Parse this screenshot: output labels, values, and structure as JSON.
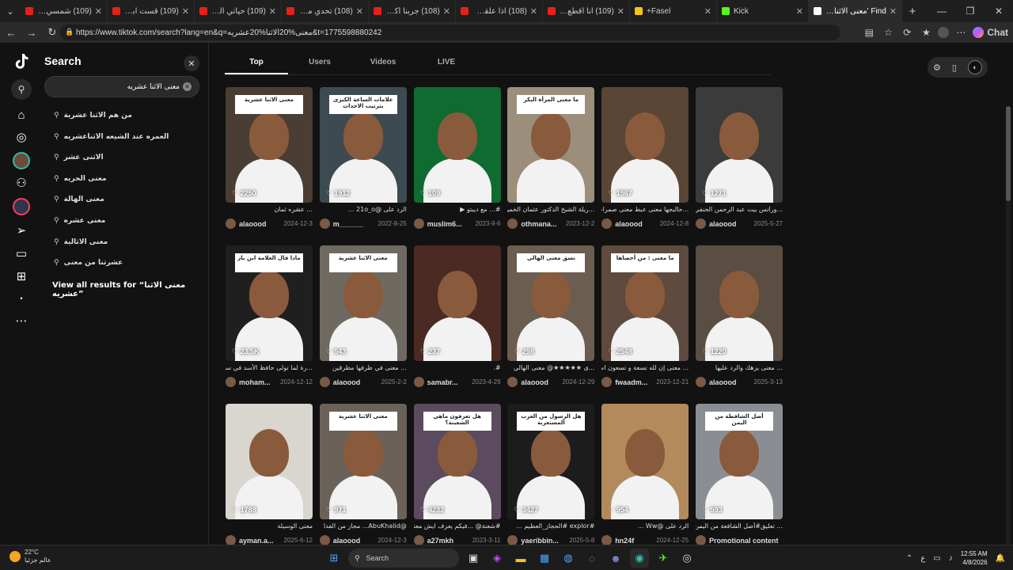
{
  "browser": {
    "tabs": [
      {
        "title": "(109) شمسي يفضح ما",
        "fav": "#e62117"
      },
      {
        "title": "(109) قست ابو عابد",
        "fav": "#e62117"
      },
      {
        "title": "(109) حياتي الجديدة",
        "fav": "#e62117"
      },
      {
        "title": "(108) تحدي مزاد الوف",
        "fav": "#e62117"
      },
      {
        "title": "(108) جربنا أكل شوار",
        "fav": "#e62117"
      },
      {
        "title": "(108) اذا علقت تتعاف",
        "fav": "#e62117"
      },
      {
        "title": "(109) أنا أقطع بدور",
        "fav": "#e62117"
      },
      {
        "title": "Fasel+",
        "fav": "#f5c518"
      },
      {
        "title": "Kick",
        "fav": "#53fc18"
      },
      {
        "title": "Find 'معنى الاثنا عشريه'",
        "fav": "#ffffff"
      }
    ],
    "url": "https://www.tiktok.com/search?lang=en&q=معنى%20الاثنا%20عشريه&t=1775598880242",
    "chat_label": "Chat"
  },
  "search": {
    "title": "Search",
    "query": "معنى الاثنا عشريه",
    "suggestions": [
      "من هم الاثنا عشرية",
      "العمره عند الشيعه الاثناعشريه",
      "الاثنى عشر",
      "معنى الحريه",
      "معنى الهالة",
      "معنى عشره",
      "معنى الاثالية",
      "عشرتنا من معنى"
    ],
    "view_all": "View all results for “معنى الاثنا عشريه”"
  },
  "results_tabs": [
    "Top",
    "Users",
    "Videos",
    "LIVE"
  ],
  "videos": [
    {
      "likes": "2250",
      "title": "... عشره ثمان",
      "user": "alaoood",
      "date": "2024-12-3",
      "bg": "#4a3d33",
      "caption": "معنى الاثنا عشرية"
    },
    {
      "likes": "1912",
      "title": "الرد على @21o_o ...",
      "user": "m______",
      "date": "2022-8-25",
      "bg": "#3d4a52",
      "caption": "علامات الساعة الكبرى بترتيب الاحداث"
    },
    {
      "likes": "109",
      "title": "#... مع ديبتو ▶",
      "user": "muslim6...",
      "date": "2023-9-6",
      "bg": "#0f6b2f",
      "caption": ""
    },
    {
      "likes": "",
      "title": "...ريلة الشيخ الدكتور عثمان الخميس",
      "user": "othmana...",
      "date": "2023-12-2",
      "bg": "#9b8f7c",
      "caption": "ما معنى المرأة البكر"
    },
    {
      "likes": "1567",
      "title": "...حالبجها معنى عبط معنى صمرات",
      "user": "alaoood",
      "date": "2024-12-8",
      "bg": "#5a4634",
      "caption": ""
    },
    {
      "likes": "1271",
      "title": "...ورانس بيت عبد الرحمن الحنفي",
      "user": "alaoood",
      "date": "2025-5-27",
      "bg": "#3b3b3b",
      "caption": ""
    },
    {
      "likes": "23.5K",
      "title": "...رة لما تولى حافظ الأسد في سوريا",
      "user": "moham...",
      "date": "2024-12-12",
      "bg": "#1f1f1f",
      "caption": "ماذا قال العلامة ابن باز"
    },
    {
      "likes": "543",
      "title": "... معنى في طرفها مطرقين",
      "user": "alaoood",
      "date": "2025-2-2",
      "bg": "#6e6a62",
      "caption": "معنى الاثنا عشرية"
    },
    {
      "likes": "237",
      "title": "#.",
      "user": "samabr...",
      "date": "2023-4-29",
      "bg": "#4a2a22",
      "caption": ""
    },
    {
      "likes": "298",
      "title": "...ى ★★★★★@ معنى الهالي",
      "user": "alaoood",
      "date": "2024-12-29",
      "bg": "#6b5d50",
      "caption": "نسق معنى الهالي"
    },
    {
      "likes": "2548",
      "title": "... معنى إن لله تسعة و تسعون اسما",
      "user": "fwaadm...",
      "date": "2023-12-21",
      "bg": "#5e4a3e",
      "caption": "ما معنى : من أحصاها"
    },
    {
      "likes": "1220",
      "title": "... معنى يزهك والرد عليها",
      "user": "alaoood",
      "date": "2025-3-13",
      "bg": "#5a4d42",
      "caption": ""
    },
    {
      "likes": "1788",
      "title": "معنى الوسيلة",
      "user": "ayman.a...",
      "date": "2025-6-12",
      "bg": "#d9d6cf",
      "caption": ""
    },
    {
      "likes": "971",
      "title": "@AbuKhalid... مجاز من الفدا",
      "user": "alaoood",
      "date": "2024-12-3",
      "bg": "#6a6258",
      "caption": "معنى الاثنا عشرية"
    },
    {
      "likes": "4232",
      "title": "#شعنة@ ...فيكم يعرف ايش معنى ؟",
      "user": "a27mkh",
      "date": "2023-3-11",
      "bg": "#5c4a5e",
      "caption": "هل تعرفون ماهي الشعبنة؟"
    },
    {
      "likes": "3427",
      "title": "#explor #الحجاز_العظيم ...",
      "user": "yaeribbin...",
      "date": "2025-5-8",
      "bg": "#1c1c1c",
      "caption": "هل الرسول من العرب المستعربة"
    },
    {
      "likes": "954",
      "title": "الرد على @Ww ...",
      "user": "hn24f",
      "date": "2024-12-25",
      "bg": "#b38a5c",
      "caption": ""
    },
    {
      "likes": "593",
      "title": "... تعليق#أصل الشافعة من اليمن",
      "user": "Promotional content",
      "date": "",
      "bg": "#8a8e93",
      "caption": "أصل الشافطة من اليمن"
    }
  ],
  "taskbar": {
    "temp": "22°C",
    "weather": "عالم جزئيا",
    "search": "Search",
    "time": "12:55 AM",
    "date": "4/8/2026"
  }
}
